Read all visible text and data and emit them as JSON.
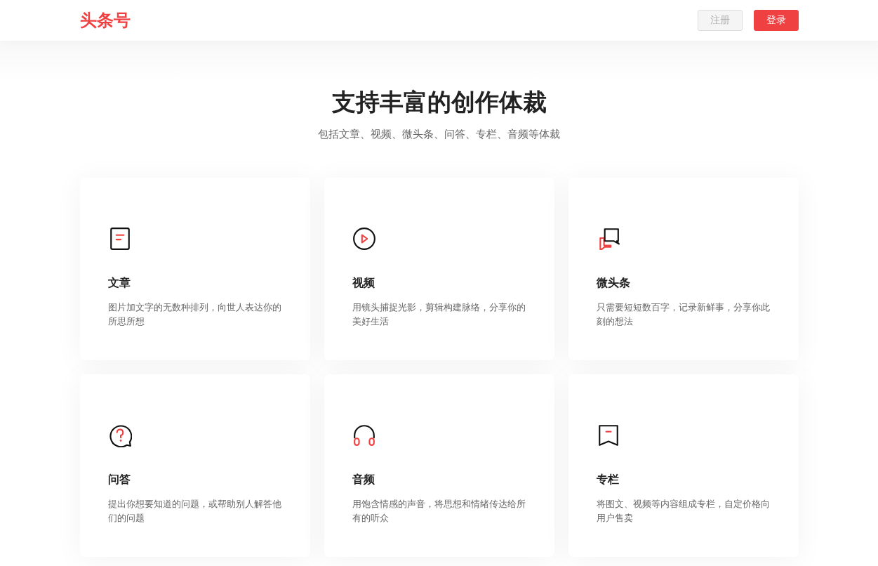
{
  "header": {
    "logo": "头条号",
    "buttons": [
      {
        "label": "注册",
        "kind": "secondary",
        "disabled": true
      },
      {
        "label": "登录",
        "kind": "primary",
        "disabled": false
      }
    ]
  },
  "section": {
    "title": "支持丰富的创作体裁",
    "subtitle": "包括文章、视频、微头条、问答、专栏、音频等体裁"
  },
  "cards": [
    {
      "kind": "article",
      "title": "文章",
      "description": "图片加文字的无数种排列，向世人表达你的所思所想"
    },
    {
      "kind": "video",
      "title": "视频",
      "description": "用镜头捕捉光影，剪辑构建脉络，分享你的美好生活"
    },
    {
      "kind": "micro",
      "title": "微头条",
      "description": "只需要短短数百字，记录新鲜事，分享你此刻的想法"
    },
    {
      "kind": "qa",
      "title": "问答",
      "description": "提出你想要知道的问题，或帮助别人解答他们的问题"
    },
    {
      "kind": "audio",
      "title": "音频",
      "description": "用饱含情感的声音，将思想和情绪传达给所有的听众"
    },
    {
      "kind": "column",
      "title": "专栏",
      "description": "将图文、视频等内容组成专栏，自定价格向用户售卖"
    }
  ]
}
